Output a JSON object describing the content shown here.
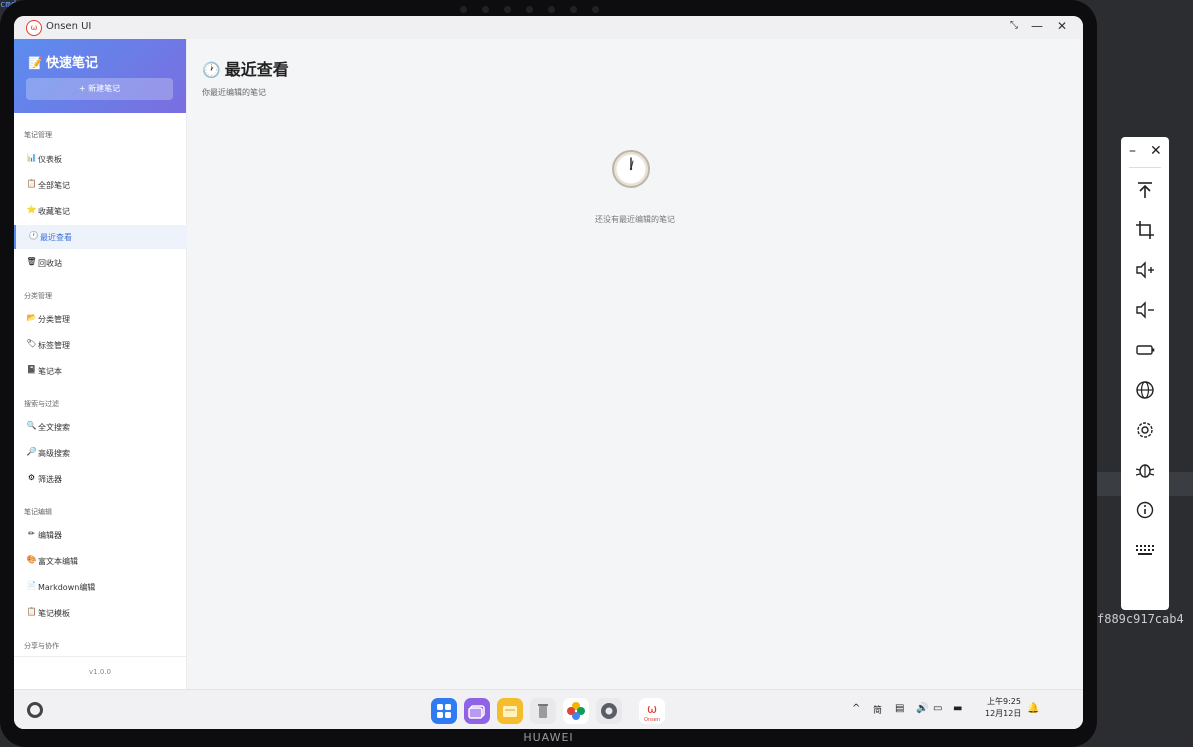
{
  "window": {
    "app_title": "Onsen UI",
    "logo_text": "Onsen"
  },
  "device": {
    "brand": "HUAWEI"
  },
  "background": {
    "hash": "f889c917cab4",
    "topleft": "cmd"
  },
  "sidebar": {
    "title": "快速笔记",
    "title_icon": "memo-icon",
    "new_note_label": "+ 新建笔记",
    "sections": [
      {
        "label": "笔记管理"
      },
      {
        "label": "分类管理"
      },
      {
        "label": "搜索与过滤"
      },
      {
        "label": "笔记编辑"
      },
      {
        "label": "分享与协作"
      }
    ],
    "items": [
      {
        "label": "仪表板",
        "icon": "📊"
      },
      {
        "label": "全部笔记",
        "icon": "📋"
      },
      {
        "label": "收藏笔记",
        "icon": "⭐"
      },
      {
        "label": "最近查看",
        "icon": "🕐"
      },
      {
        "label": "回收站",
        "icon": "🗑"
      },
      {
        "label": "分类管理",
        "icon": "📂"
      },
      {
        "label": "标签管理",
        "icon": "🏷"
      },
      {
        "label": "笔记本",
        "icon": "📓"
      },
      {
        "label": "全文搜索",
        "icon": "🔍"
      },
      {
        "label": "高级搜索",
        "icon": "🔎"
      },
      {
        "label": "筛选器",
        "icon": "⚙"
      },
      {
        "label": "编辑器",
        "icon": "✏"
      },
      {
        "label": "富文本编辑",
        "icon": "🎨"
      },
      {
        "label": "Markdown编辑",
        "icon": "📄"
      },
      {
        "label": "笔记模板",
        "icon": "📋"
      }
    ],
    "active_item": "最近查看",
    "version": "v1.0.0"
  },
  "main": {
    "title": "最近查看",
    "title_icon": "🕐",
    "subtitle": "你最近编辑的笔记",
    "empty_text": "还没有最近编辑的笔记"
  },
  "taskbar": {
    "dock": [
      "app-grid",
      "multitask",
      "notes",
      "trash",
      "gallery",
      "settings",
      "onsen-ui"
    ],
    "ime": "简",
    "time": "上午9:25",
    "date": "12月12日"
  },
  "tools_panel": {
    "icons": [
      "scroll-top-icon",
      "crop-icon",
      "volume-up-icon",
      "volume-down-icon",
      "battery-icon",
      "globe-icon",
      "settings-icon",
      "bug-icon",
      "info-icon",
      "keyboard-icon"
    ]
  },
  "colors": {
    "accent": "#5b8def",
    "header_gradient_end": "#7a6ee0",
    "active_text": "#3b6fd8",
    "brand_red": "#e03a2f"
  }
}
